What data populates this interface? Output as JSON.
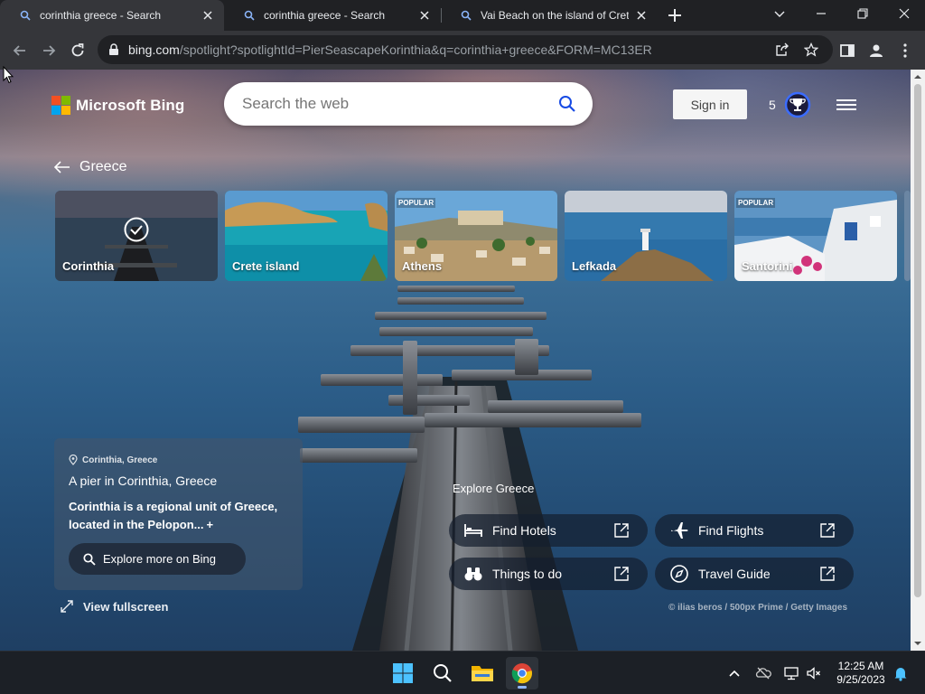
{
  "browser": {
    "tabs": [
      {
        "title": "corinthia greece - Search",
        "active": true
      },
      {
        "title": "corinthia greece - Search",
        "active": false
      },
      {
        "title": "Vai Beach on the island of Crete, ...",
        "active": false
      }
    ],
    "address": {
      "host": "bing.com",
      "path": "/spotlight?spotlightId=PierSeascapeKorinthia&q=corinthia+greece&FORM=MC13ER"
    }
  },
  "bing": {
    "logo_text": "Microsoft Bing",
    "logo_colors": [
      "#f25022",
      "#7fba00",
      "#00a4ef",
      "#ffb900"
    ],
    "search_placeholder": "Search the web",
    "sign_in": "Sign in",
    "rewards_count": "5",
    "back_label": "Greece",
    "carousel": [
      {
        "name": "Corinthia",
        "badge": "",
        "selected": true
      },
      {
        "name": "Crete island",
        "badge": "",
        "selected": false
      },
      {
        "name": "Athens",
        "badge": "POPULAR",
        "selected": false
      },
      {
        "name": "Lefkada",
        "badge": "",
        "selected": false
      },
      {
        "name": "Santorini",
        "badge": "POPULAR",
        "selected": false
      }
    ],
    "info": {
      "location": "Corinthia, Greece",
      "title": "A pier in Corinthia, Greece",
      "description": "Corinthia is a regional unit of Greece, located in the Pelopon...",
      "plus": "+",
      "explore_button": "Explore more on Bing"
    },
    "view_fullscreen": "View fullscreen",
    "explore": {
      "title": "Explore Greece",
      "actions": [
        {
          "label": "Find Hotels",
          "icon": "bed-icon"
        },
        {
          "label": "Find Flights",
          "icon": "airplane-icon"
        },
        {
          "label": "Things to do",
          "icon": "binoculars-icon"
        },
        {
          "label": "Travel Guide",
          "icon": "compass-icon"
        }
      ]
    },
    "credit": "© ilias beros / 500px Prime / Getty Images"
  },
  "taskbar": {
    "time": "12:25 AM",
    "date": "9/25/2023"
  }
}
